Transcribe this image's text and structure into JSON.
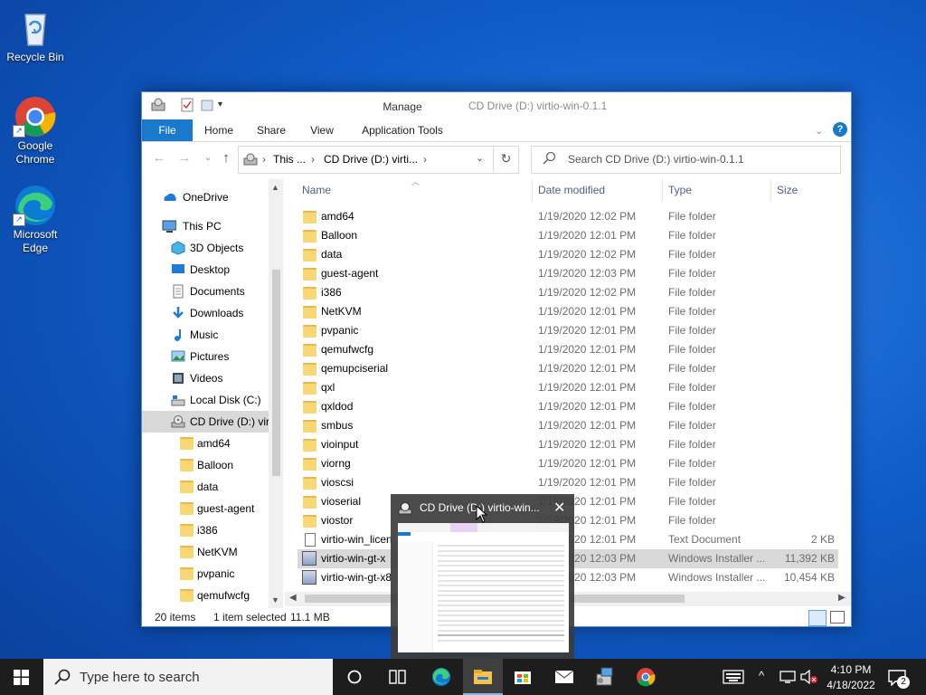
{
  "desktop": {
    "icons": [
      {
        "label": "Recycle Bin",
        "icon": "recycle-bin-icon"
      },
      {
        "label": "Google Chrome",
        "icon": "chrome-icon"
      },
      {
        "label": "Microsoft Edge",
        "icon": "edge-icon"
      }
    ]
  },
  "explorer": {
    "title": "CD Drive (D:) virtio-win-0.1.1",
    "context_tab_group": "Manage",
    "tabs": [
      "File",
      "Home",
      "Share",
      "View",
      "Application Tools"
    ],
    "address": {
      "parts": [
        "This ...",
        "CD Drive (D:) virti..."
      ],
      "search_placeholder": "Search CD Drive (D:) virtio-win-0.1.1"
    },
    "nav": [
      {
        "label": "OneDrive",
        "icon": "onedrive-icon"
      },
      {
        "label": "This PC",
        "icon": "this-pc-icon"
      },
      {
        "label": "3D Objects",
        "icon": "3d-objects-icon"
      },
      {
        "label": "Desktop",
        "icon": "desktop-icon"
      },
      {
        "label": "Documents",
        "icon": "documents-icon"
      },
      {
        "label": "Downloads",
        "icon": "downloads-icon"
      },
      {
        "label": "Music",
        "icon": "music-icon"
      },
      {
        "label": "Pictures",
        "icon": "pictures-icon"
      },
      {
        "label": "Videos",
        "icon": "videos-icon"
      },
      {
        "label": "Local Disk (C:)",
        "icon": "local-disk-icon"
      },
      {
        "label": "CD Drive (D:) virt",
        "icon": "cd-drive-icon"
      },
      {
        "label": "amd64",
        "icon": "folder-icon"
      },
      {
        "label": "Balloon",
        "icon": "folder-icon"
      },
      {
        "label": "data",
        "icon": "folder-icon"
      },
      {
        "label": "guest-agent",
        "icon": "folder-icon"
      },
      {
        "label": "i386",
        "icon": "folder-icon"
      },
      {
        "label": "NetKVM",
        "icon": "folder-icon"
      },
      {
        "label": "pvpanic",
        "icon": "folder-icon"
      },
      {
        "label": "qemufwcfg",
        "icon": "folder-icon"
      }
    ],
    "columns": [
      "Name",
      "Date modified",
      "Type",
      "Size"
    ],
    "files": [
      {
        "name": "amd64",
        "date": "1/19/2020 12:02 PM",
        "type": "File folder",
        "size": "",
        "icon": "folder-icon"
      },
      {
        "name": "Balloon",
        "date": "1/19/2020 12:01 PM",
        "type": "File folder",
        "size": "",
        "icon": "folder-icon"
      },
      {
        "name": "data",
        "date": "1/19/2020 12:02 PM",
        "type": "File folder",
        "size": "",
        "icon": "folder-icon"
      },
      {
        "name": "guest-agent",
        "date": "1/19/2020 12:03 PM",
        "type": "File folder",
        "size": "",
        "icon": "folder-icon"
      },
      {
        "name": "i386",
        "date": "1/19/2020 12:02 PM",
        "type": "File folder",
        "size": "",
        "icon": "folder-icon"
      },
      {
        "name": "NetKVM",
        "date": "1/19/2020 12:01 PM",
        "type": "File folder",
        "size": "",
        "icon": "folder-icon"
      },
      {
        "name": "pvpanic",
        "date": "1/19/2020 12:01 PM",
        "type": "File folder",
        "size": "",
        "icon": "folder-icon"
      },
      {
        "name": "qemufwcfg",
        "date": "1/19/2020 12:01 PM",
        "type": "File folder",
        "size": "",
        "icon": "folder-icon"
      },
      {
        "name": "qemupciserial",
        "date": "1/19/2020 12:01 PM",
        "type": "File folder",
        "size": "",
        "icon": "folder-icon"
      },
      {
        "name": "qxl",
        "date": "1/19/2020 12:01 PM",
        "type": "File folder",
        "size": "",
        "icon": "folder-icon"
      },
      {
        "name": "qxldod",
        "date": "1/19/2020 12:01 PM",
        "type": "File folder",
        "size": "",
        "icon": "folder-icon"
      },
      {
        "name": "smbus",
        "date": "1/19/2020 12:01 PM",
        "type": "File folder",
        "size": "",
        "icon": "folder-icon"
      },
      {
        "name": "vioinput",
        "date": "1/19/2020 12:01 PM",
        "type": "File folder",
        "size": "",
        "icon": "folder-icon"
      },
      {
        "name": "viorng",
        "date": "1/19/2020 12:01 PM",
        "type": "File folder",
        "size": "",
        "icon": "folder-icon"
      },
      {
        "name": "vioscsi",
        "date": "1/19/2020 12:01 PM",
        "type": "File folder",
        "size": "",
        "icon": "folder-icon"
      },
      {
        "name": "vioserial",
        "date": "1/19/2020 12:01 PM",
        "type": "File folder",
        "size": "",
        "icon": "folder-icon"
      },
      {
        "name": "viostor",
        "date": "1/19/2020 12:01 PM",
        "type": "File folder",
        "size": "",
        "icon": "folder-icon"
      },
      {
        "name": "virtio-win_licen",
        "date": "1/19/2020 12:01 PM",
        "type": "Text Document",
        "size": "2 KB",
        "icon": "text-file-icon"
      },
      {
        "name": "virtio-win-gt-x",
        "date": "1/19/2020 12:03 PM",
        "type": "Windows Installer ...",
        "size": "11,392 KB",
        "icon": "installer-icon"
      },
      {
        "name": "virtio-win-gt-x8",
        "date": "1/19/2020 12:03 PM",
        "type": "Windows Installer ...",
        "size": "10,454 KB",
        "icon": "installer-icon"
      }
    ],
    "selected_row": 18,
    "status": {
      "count": "20 items",
      "selected": "1 item selected",
      "size": "11.1 MB"
    }
  },
  "thumbnail": {
    "title": "CD Drive (D:) virtio-win..."
  },
  "taskbar": {
    "search_placeholder": "Type here to search",
    "time": "4:10 PM",
    "date": "4/18/2022",
    "notification_count": "2"
  },
  "colors": {
    "accent": "#1979ca",
    "manage": "#e9d3f3",
    "selection": "#d9d9d9"
  }
}
